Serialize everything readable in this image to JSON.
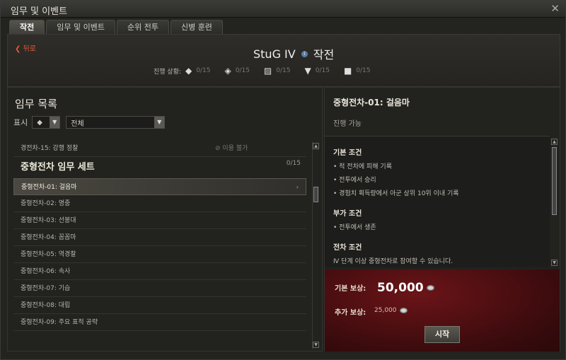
{
  "window": {
    "title": "임무 및 이벤트",
    "close_glyph": "✕"
  },
  "tabs": [
    {
      "label": "작전"
    },
    {
      "label": "임무 및 이벤트"
    },
    {
      "label": "순위 전투"
    },
    {
      "label": "신병 훈련"
    }
  ],
  "header": {
    "back_label": "뒤로",
    "vehicle": "StuG IV",
    "mode": "작전",
    "progress_label": "진행 상황:",
    "progress": [
      {
        "icon": "diamond-icon",
        "count": "0/15"
      },
      {
        "icon": "chevron-icon",
        "count": "0/15"
      },
      {
        "icon": "stripes-icon",
        "count": "0/15"
      },
      {
        "icon": "triangle-icon",
        "count": "0/15"
      },
      {
        "icon": "square-icon",
        "count": "0/15"
      }
    ]
  },
  "left": {
    "title": "임무 목록",
    "filter_label": "표시",
    "filter_value": "전체",
    "locked_row": {
      "label": "경전차-15: 강행 정찰",
      "status": "이용 불가"
    },
    "section": {
      "title": "중형전차 임무 세트",
      "count": "0/15"
    },
    "rows": [
      "중형전차-01: 걸음마",
      "중형전차-02: 명중",
      "중형전차-03: 선봉대",
      "중형전차-04: 꼼꼼마",
      "중형전차-05: 역경찰",
      "중형전차-06: 속사",
      "중형전차-07: 기습",
      "중형전차-08: 대립",
      "중형전차-09: 주요 표적 공략"
    ]
  },
  "right": {
    "title": "중형전차-01: 걸음마",
    "status": "진행 가능",
    "basic_title": "기본 조건",
    "basic_items": [
      "• 적 전차에 피해 기록",
      "• 전투에서 승리",
      "• 경험치 획득량에서 아군 상위 10위 이내 기록"
    ],
    "extra_title": "부가 조건",
    "extra_items": [
      "• 전투에서 생존"
    ],
    "tank_title": "전차 조건",
    "tank_text": "Ⅳ 단계 이상 중형전차로 참여할 수 있습니다.",
    "reward_base_label": "기본 보상:",
    "reward_base_value": "50,000",
    "reward_extra_label": "추가 보상:",
    "reward_extra_value": "25,000",
    "start_label": "시작"
  }
}
